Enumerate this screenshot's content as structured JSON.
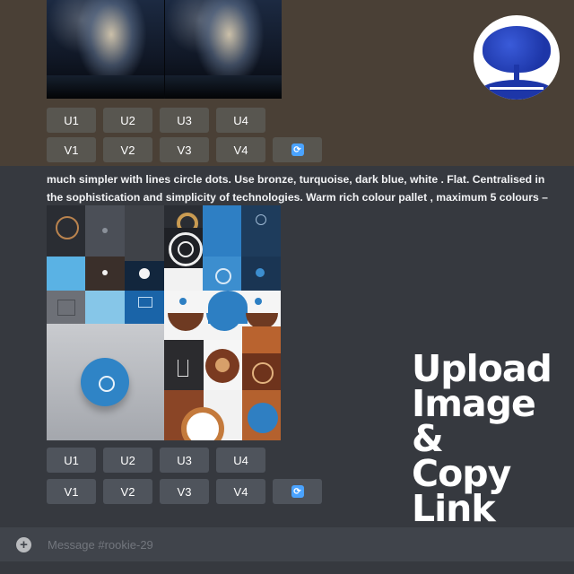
{
  "prev_message": {
    "upscale_buttons": [
      "U1",
      "U2",
      "U3",
      "U4"
    ],
    "variation_buttons": [
      "V1",
      "V2",
      "V3",
      "V4"
    ]
  },
  "current_message": {
    "prompt_line_1": "much simpler with lines circle dots. Use bronze, turquoise, dark blue, white . Flat. Centralised in",
    "prompt_line_2": "the sophistication and simplicity of technologies. Warm rich colour pallet , maximum 5 colours –",
    "upscale_buttons": [
      "U1",
      "U2",
      "U3",
      "U4"
    ],
    "variation_buttons": [
      "V1",
      "V2",
      "V3",
      "V4"
    ]
  },
  "overlay_caption": {
    "line_1": "Upload",
    "line_2": "Image &",
    "line_3": "Copy",
    "line_4": "Link"
  },
  "composer": {
    "placeholder": "Message #rookie-29"
  },
  "icons": {
    "refresh": "refresh-icon",
    "add": "plus-circle-icon",
    "logo": "tree-logo-icon"
  },
  "colors": {
    "button_bg": "#4f545c",
    "refresh_accent": "#4aa3ff",
    "chat_bg": "#36393f",
    "composer_bg": "#40444b"
  }
}
